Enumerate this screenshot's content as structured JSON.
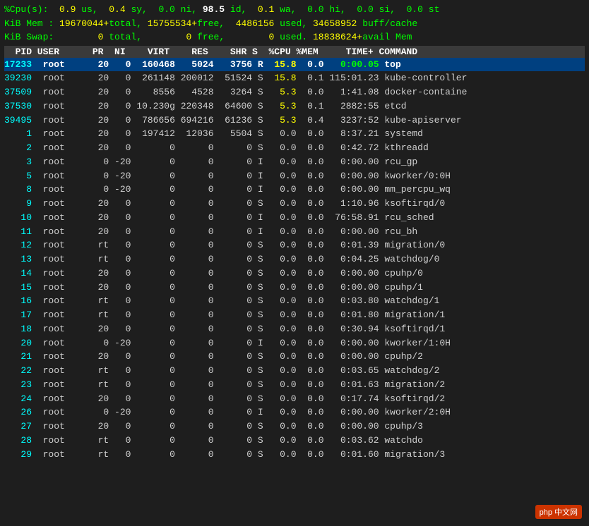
{
  "terminal": {
    "header": [
      "%Cpu(s):  0.9 us,  0.4 sy,  0.0 ni, 98.5 id,  0.1 wa,  0.0 hi,  0.0 si,  0.0 st",
      "KiB Mem : 19670044+total, 15755534+free,  4486156 used, 34658952 buff/cache",
      "KiB Swap:        0 total,        0 free,        0 used. 18838624+avail Mem"
    ],
    "table_header": "  PID USER      PR  NI    VIRT    RES    SHR S  %CPU %MEM     TIME+ COMMAND",
    "processes": [
      {
        "pid": "17233",
        "user": "root",
        "pr": "20",
        "ni": "0",
        "virt": "160468",
        "res": "5024",
        "shr": "3756",
        "s": "R",
        "cpu": "15.8",
        "mem": "0.0",
        "time": "0:00.05",
        "cmd": "top",
        "highlight": true
      },
      {
        "pid": "39230",
        "user": "root",
        "pr": "20",
        "ni": "0",
        "virt": "261148",
        "res": "200012",
        "shr": "51524",
        "s": "S",
        "cpu": "15.8",
        "mem": "0.1",
        "time": "115:01.23",
        "cmd": "kube-controller"
      },
      {
        "pid": "37509",
        "user": "root",
        "pr": "20",
        "ni": "0",
        "virt": "8556",
        "res": "4528",
        "shr": "3264",
        "s": "S",
        "cpu": "5.3",
        "mem": "0.0",
        "time": "1:41.08",
        "cmd": "docker-containe"
      },
      {
        "pid": "37530",
        "user": "root",
        "pr": "20",
        "ni": "0",
        "virt": "10.230g",
        "res": "220348",
        "shr": "64600",
        "s": "S",
        "cpu": "5.3",
        "mem": "0.1",
        "time": "2882:55",
        "cmd": "etcd"
      },
      {
        "pid": "39495",
        "user": "root",
        "pr": "20",
        "ni": "0",
        "virt": "786656",
        "res": "694216",
        "shr": "61236",
        "s": "S",
        "cpu": "5.3",
        "mem": "0.4",
        "time": "3237:52",
        "cmd": "kube-apiserver"
      },
      {
        "pid": "1",
        "user": "root",
        "pr": "20",
        "ni": "0",
        "virt": "197412",
        "res": "12036",
        "shr": "5504",
        "s": "S",
        "cpu": "0.0",
        "mem": "0.0",
        "time": "8:37.21",
        "cmd": "systemd"
      },
      {
        "pid": "2",
        "user": "root",
        "pr": "20",
        "ni": "0",
        "virt": "0",
        "res": "0",
        "shr": "0",
        "s": "S",
        "cpu": "0.0",
        "mem": "0.0",
        "time": "0:42.72",
        "cmd": "kthreadd"
      },
      {
        "pid": "3",
        "user": "root",
        "pr": "0",
        "ni": "-20",
        "virt": "0",
        "res": "0",
        "shr": "0",
        "s": "I",
        "cpu": "0.0",
        "mem": "0.0",
        "time": "0:00.00",
        "cmd": "rcu_gp"
      },
      {
        "pid": "5",
        "user": "root",
        "pr": "0",
        "ni": "-20",
        "virt": "0",
        "res": "0",
        "shr": "0",
        "s": "I",
        "cpu": "0.0",
        "mem": "0.0",
        "time": "0:00.00",
        "cmd": "kworker/0:0H"
      },
      {
        "pid": "8",
        "user": "root",
        "pr": "0",
        "ni": "-20",
        "virt": "0",
        "res": "0",
        "shr": "0",
        "s": "I",
        "cpu": "0.0",
        "mem": "0.0",
        "time": "0:00.00",
        "cmd": "mm_percpu_wq"
      },
      {
        "pid": "9",
        "user": "root",
        "pr": "20",
        "ni": "0",
        "virt": "0",
        "res": "0",
        "shr": "0",
        "s": "S",
        "cpu": "0.0",
        "mem": "0.0",
        "time": "1:10.96",
        "cmd": "ksoftirqd/0"
      },
      {
        "pid": "10",
        "user": "root",
        "pr": "20",
        "ni": "0",
        "virt": "0",
        "res": "0",
        "shr": "0",
        "s": "I",
        "cpu": "0.0",
        "mem": "0.0",
        "time": "76:58.91",
        "cmd": "rcu_sched"
      },
      {
        "pid": "11",
        "user": "root",
        "pr": "20",
        "ni": "0",
        "virt": "0",
        "res": "0",
        "shr": "0",
        "s": "I",
        "cpu": "0.0",
        "mem": "0.0",
        "time": "0:00.00",
        "cmd": "rcu_bh"
      },
      {
        "pid": "12",
        "user": "root",
        "pr": "rt",
        "ni": "0",
        "virt": "0",
        "res": "0",
        "shr": "0",
        "s": "S",
        "cpu": "0.0",
        "mem": "0.0",
        "time": "0:01.39",
        "cmd": "migration/0"
      },
      {
        "pid": "13",
        "user": "root",
        "pr": "rt",
        "ni": "0",
        "virt": "0",
        "res": "0",
        "shr": "0",
        "s": "S",
        "cpu": "0.0",
        "mem": "0.0",
        "time": "0:04.25",
        "cmd": "watchdog/0"
      },
      {
        "pid": "14",
        "user": "root",
        "pr": "20",
        "ni": "0",
        "virt": "0",
        "res": "0",
        "shr": "0",
        "s": "S",
        "cpu": "0.0",
        "mem": "0.0",
        "time": "0:00.00",
        "cmd": "cpuhp/0"
      },
      {
        "pid": "15",
        "user": "root",
        "pr": "20",
        "ni": "0",
        "virt": "0",
        "res": "0",
        "shr": "0",
        "s": "S",
        "cpu": "0.0",
        "mem": "0.0",
        "time": "0:00.00",
        "cmd": "cpuhp/1"
      },
      {
        "pid": "16",
        "user": "root",
        "pr": "rt",
        "ni": "0",
        "virt": "0",
        "res": "0",
        "shr": "0",
        "s": "S",
        "cpu": "0.0",
        "mem": "0.0",
        "time": "0:03.80",
        "cmd": "watchdog/1"
      },
      {
        "pid": "17",
        "user": "root",
        "pr": "rt",
        "ni": "0",
        "virt": "0",
        "res": "0",
        "shr": "0",
        "s": "S",
        "cpu": "0.0",
        "mem": "0.0",
        "time": "0:01.80",
        "cmd": "migration/1"
      },
      {
        "pid": "18",
        "user": "root",
        "pr": "20",
        "ni": "0",
        "virt": "0",
        "res": "0",
        "shr": "0",
        "s": "S",
        "cpu": "0.0",
        "mem": "0.0",
        "time": "0:30.94",
        "cmd": "ksoftirqd/1"
      },
      {
        "pid": "20",
        "user": "root",
        "pr": "0",
        "ni": "-20",
        "virt": "0",
        "res": "0",
        "shr": "0",
        "s": "I",
        "cpu": "0.0",
        "mem": "0.0",
        "time": "0:00.00",
        "cmd": "kworker/1:0H"
      },
      {
        "pid": "21",
        "user": "root",
        "pr": "20",
        "ni": "0",
        "virt": "0",
        "res": "0",
        "shr": "0",
        "s": "S",
        "cpu": "0.0",
        "mem": "0.0",
        "time": "0:00.00",
        "cmd": "cpuhp/2"
      },
      {
        "pid": "22",
        "user": "root",
        "pr": "rt",
        "ni": "0",
        "virt": "0",
        "res": "0",
        "shr": "0",
        "s": "S",
        "cpu": "0.0",
        "mem": "0.0",
        "time": "0:03.65",
        "cmd": "watchdog/2"
      },
      {
        "pid": "23",
        "user": "root",
        "pr": "rt",
        "ni": "0",
        "virt": "0",
        "res": "0",
        "shr": "0",
        "s": "S",
        "cpu": "0.0",
        "mem": "0.0",
        "time": "0:01.63",
        "cmd": "migration/2"
      },
      {
        "pid": "24",
        "user": "root",
        "pr": "20",
        "ni": "0",
        "virt": "0",
        "res": "0",
        "shr": "0",
        "s": "S",
        "cpu": "0.0",
        "mem": "0.0",
        "time": "0:17.74",
        "cmd": "ksoftirqd/2"
      },
      {
        "pid": "26",
        "user": "root",
        "pr": "0",
        "ni": "-20",
        "virt": "0",
        "res": "0",
        "shr": "0",
        "s": "I",
        "cpu": "0.0",
        "mem": "0.0",
        "time": "0:00.00",
        "cmd": "kworker/2:0H"
      },
      {
        "pid": "27",
        "user": "root",
        "pr": "20",
        "ni": "0",
        "virt": "0",
        "res": "0",
        "shr": "0",
        "s": "S",
        "cpu": "0.0",
        "mem": "0.0",
        "time": "0:00.00",
        "cmd": "cpuhp/3"
      },
      {
        "pid": "28",
        "user": "root",
        "pr": "rt",
        "ni": "0",
        "virt": "0",
        "res": "0",
        "shr": "0",
        "s": "S",
        "cpu": "0.0",
        "mem": "0.0",
        "time": "0:03.62",
        "cmd": "watchdo"
      },
      {
        "pid": "29",
        "user": "root",
        "pr": "rt",
        "ni": "0",
        "virt": "0",
        "res": "0",
        "shr": "0",
        "s": "S",
        "cpu": "0.0",
        "mem": "0.0",
        "time": "0:01.60",
        "cmd": "migration/3"
      }
    ]
  }
}
